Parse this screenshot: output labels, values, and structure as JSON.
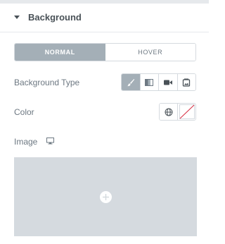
{
  "section": {
    "title": "Background",
    "caret_icon": "caret-down-icon"
  },
  "tabs": [
    {
      "label": "NORMAL",
      "active": true
    },
    {
      "label": "HOVER",
      "active": false
    }
  ],
  "background_type": {
    "label": "Background Type",
    "options": [
      {
        "icon": "brush-icon",
        "active": true
      },
      {
        "icon": "gradient-icon",
        "active": false
      },
      {
        "icon": "video-icon",
        "active": false
      },
      {
        "icon": "slideshow-icon",
        "active": false
      }
    ]
  },
  "color": {
    "label": "Color",
    "controls": [
      {
        "icon": "globe-icon"
      },
      {
        "icon": "no-color-swatch-icon"
      }
    ]
  },
  "image": {
    "label": "Image",
    "responsive_icon": "desktop-icon",
    "add_icon": "plus-circle-icon"
  },
  "colors": {
    "active_tab_bg": "#a4afb7",
    "text": "#6d7882",
    "heading": "#495157",
    "border": "#d5dadf",
    "image_placeholder": "#d5dadf",
    "no_color_slash": "#d72b3f"
  }
}
